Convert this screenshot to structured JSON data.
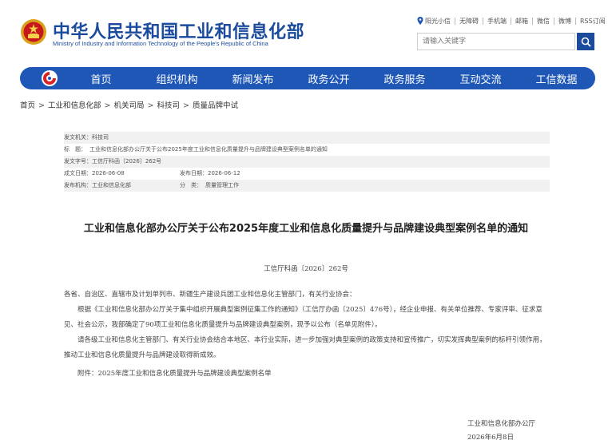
{
  "header": {
    "title_cn": "中华人民共和国工业和信息化部",
    "title_en": "Ministry of Industry and Information Technology of the People's Republic of China",
    "emblem_icon": "national-emblem-icon",
    "top_links": [
      "阳光小信",
      "无障碍",
      "手机端",
      "邮箱",
      "微信",
      "微博",
      "RSS订阅"
    ],
    "search_placeholder": "请输入关键字"
  },
  "nav": {
    "items": [
      "首页",
      "组织机构",
      "新闻发布",
      "政务公开",
      "政务服务",
      "互动交流",
      "工信数据"
    ],
    "color": "#1f57b6"
  },
  "breadcrumb": [
    "首页",
    "工业和信息化部",
    "机关司局",
    "科技司",
    "质量品牌中试"
  ],
  "meta": {
    "issuer_label": "发文机关：",
    "issuer": "科技司",
    "title_label": "标　题：",
    "title": "工业和信息化部办公厅关于公布2025年度工业和信息化质量提升与品牌建设典型案例名单的通知",
    "doc_no_label": "发文字号：",
    "doc_no": "工信厅科函〔2026〕262号",
    "date_label": "成文日期：",
    "date": "2026-06-08",
    "publish_label": "发布日期：",
    "publish_date": "2026-06-12",
    "org_label": "发布机构：",
    "org": "工业和信息化部",
    "category_label": "分　类：",
    "category": "质量管理工作"
  },
  "document": {
    "title": "工业和信息化部办公厅关于公布2025年度工业和信息化质量提升与品牌建设典型案例名单的通知",
    "number": "工信厅科函〔2026〕262号",
    "salutation": "各省、自治区、直辖市及计划单列市、新疆生产建设兵团工业和信息化主管部门，有关行业协会：",
    "paragraph1": "根据《工业和信息化部办公厅关于集中组织开展典型案例征集工作的通知》（工信厅办函〔2025〕476号），经企业申报、有关单位推荐、专家评审、征求意见、社会公示，我部确定了90项工业和信息化质量提升与品牌建设典型案例，现予以公布（名单见附件）。",
    "paragraph2": "请各级工业和信息化主管部门、有关行业协会结合本地区、本行业实际，进一步加强对典型案例的政策支持和宣传推广，切实发挥典型案例的标杆引领作用，推动工业和信息化质量提升与品牌建设取得新成效。",
    "attachment": "附件：2025年度工业和信息化质量提升与品牌建设典型案例名单",
    "signature": "工业和信息化部办公厅",
    "sign_date": "2026年6月8日"
  }
}
